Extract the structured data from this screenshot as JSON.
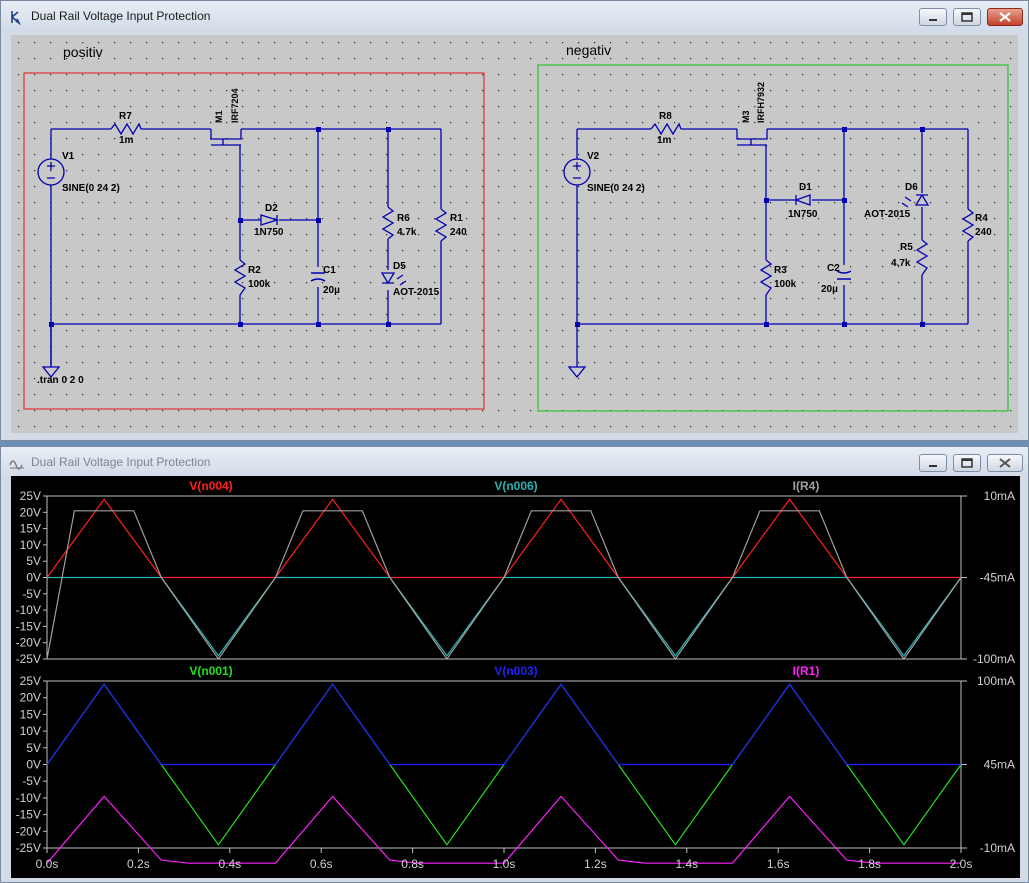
{
  "schematic_window": {
    "title": "Dual Rail Voltage Input Protection",
    "sections": {
      "positive": "positiv",
      "negative": "negativ"
    },
    "directive": ".tran 0 2 0",
    "components": {
      "V1": {
        "name": "V1",
        "value": "SINE(0 24 2)"
      },
      "V2": {
        "name": "V2",
        "value": "SINE(0 24 2)"
      },
      "R7": {
        "name": "R7",
        "value": "1m"
      },
      "R8": {
        "name": "R8",
        "value": "1m"
      },
      "M1": {
        "name": "M1",
        "value": "IRF7204"
      },
      "M3": {
        "name": "M3",
        "value": "IRFH7932"
      },
      "D2": {
        "name": "D2",
        "value": "1N750"
      },
      "D1": {
        "name": "D1",
        "value": "1N750"
      },
      "R2": {
        "name": "R2",
        "value": "100k"
      },
      "R3": {
        "name": "R3",
        "value": "100k"
      },
      "C1": {
        "name": "C1",
        "value": "20µ"
      },
      "C2": {
        "name": "C2",
        "value": "20µ"
      },
      "R6": {
        "name": "R6",
        "value": "4.7k"
      },
      "R5": {
        "name": "R5",
        "value": "4.7k"
      },
      "D5": {
        "name": "D5",
        "value": "AOT-2015"
      },
      "D6": {
        "name": "D6",
        "value": "AOT-2015"
      },
      "R1": {
        "name": "R1",
        "value": "240"
      },
      "R4": {
        "name": "R4",
        "value": "240"
      }
    },
    "colors": {
      "positive_box": "#e03030",
      "negative_box": "#30c030",
      "wire": "#0000b0"
    }
  },
  "waveform_window": {
    "title": "Dual Rail Voltage Input Protection",
    "top_pane": {
      "traces": [
        {
          "label": "V(n004)",
          "color": "#ff2020"
        },
        {
          "label": "V(n006)",
          "color": "#2bb3b3"
        },
        {
          "label": "I(R4)",
          "color": "#a0a0a0"
        }
      ],
      "left_ticks": [
        "25V",
        "20V",
        "15V",
        "10V",
        "5V",
        "0V",
        "-5V",
        "-10V",
        "-15V",
        "-20V",
        "-25V"
      ],
      "right_ticks": [
        "10mA",
        "-45mA",
        "-100mA"
      ]
    },
    "bottom_pane": {
      "traces": [
        {
          "label": "V(n001)",
          "color": "#20e020"
        },
        {
          "label": "V(n003)",
          "color": "#2020ff"
        },
        {
          "label": "I(R1)",
          "color": "#ff20ff"
        }
      ],
      "left_ticks": [
        "25V",
        "20V",
        "15V",
        "10V",
        "5V",
        "0V",
        "-5V",
        "-10V",
        "-15V",
        "-20V",
        "-25V"
      ],
      "right_ticks": [
        "100mA",
        "45mA",
        "-10mA"
      ]
    },
    "x_ticks": [
      "0.0s",
      "0.2s",
      "0.4s",
      "0.6s",
      "0.8s",
      "1.0s",
      "1.2s",
      "1.4s",
      "1.6s",
      "1.8s",
      "2.0s"
    ]
  },
  "chart_data": [
    {
      "type": "line",
      "x_range": [
        0,
        2
      ],
      "ylim": [
        -25,
        25
      ],
      "y2lim": [
        -100,
        10
      ],
      "series": [
        {
          "name": "V(n004)",
          "x": [
            0,
            0.125,
            0.25,
            0.375,
            0.5,
            0.625,
            0.75,
            0.875,
            1.0,
            1.125,
            1.25,
            1.375,
            1.5,
            1.625,
            1.75,
            1.875,
            2.0
          ],
          "values": [
            0,
            24,
            0,
            0,
            0,
            24,
            0,
            0,
            0,
            24,
            0,
            0,
            0,
            24,
            0,
            0,
            0
          ]
        },
        {
          "name": "V(n006)",
          "x": [
            0,
            0.25,
            0.375,
            0.5,
            0.75,
            0.875,
            1.0,
            1.25,
            1.375,
            1.5,
            1.75,
            1.875,
            2.0
          ],
          "values": [
            0,
            0,
            -24,
            0,
            0,
            -24,
            0,
            0,
            -24,
            0,
            0,
            -24,
            0
          ]
        },
        {
          "name": "I(R4)",
          "x": [
            0,
            0.06,
            0.19,
            0.25,
            0.375,
            0.5,
            0.56,
            0.69,
            0.75,
            0.875,
            1.0,
            1.06,
            1.19,
            1.25,
            1.375,
            1.5,
            1.56,
            1.69,
            1.75,
            1.875,
            2.0
          ],
          "values": [
            -100,
            0,
            0,
            -45,
            -100,
            -45,
            0,
            0,
            -45,
            -100,
            -45,
            0,
            0,
            -45,
            -100,
            -45,
            0,
            0,
            -45,
            -100,
            -45
          ]
        }
      ]
    },
    {
      "type": "line",
      "x_range": [
        0,
        2
      ],
      "ylim": [
        -25,
        25
      ],
      "y2lim": [
        -10,
        100
      ],
      "series": [
        {
          "name": "V(n001)",
          "x": [
            0,
            0.125,
            0.25,
            0.375,
            0.5,
            0.625,
            0.75,
            0.875,
            1.0,
            1.125,
            1.25,
            1.375,
            1.5,
            1.625,
            1.75,
            1.875,
            2.0
          ],
          "values": [
            0,
            24,
            0,
            -24,
            0,
            24,
            0,
            -24,
            0,
            24,
            0,
            -24,
            0,
            24,
            0,
            -24,
            0
          ]
        },
        {
          "name": "V(n003)",
          "x": [
            0,
            0.125,
            0.25,
            0.5,
            0.625,
            0.75,
            1.0,
            1.125,
            1.25,
            1.5,
            1.625,
            1.75,
            2.0
          ],
          "values": [
            0,
            24,
            0,
            0,
            24,
            0,
            0,
            24,
            0,
            0,
            24,
            0,
            0
          ]
        },
        {
          "name": "I(R1)",
          "x": [
            0,
            0.125,
            0.25,
            0.31,
            0.5,
            0.625,
            0.75,
            0.81,
            1.0,
            1.125,
            1.25,
            1.31,
            1.5,
            1.625,
            1.75,
            1.81,
            2.0
          ],
          "values": [
            -20,
            24,
            -18,
            -20,
            -20,
            24,
            -18,
            -20,
            -20,
            24,
            -18,
            -20,
            -20,
            24,
            -18,
            -20,
            -20
          ]
        }
      ]
    }
  ]
}
